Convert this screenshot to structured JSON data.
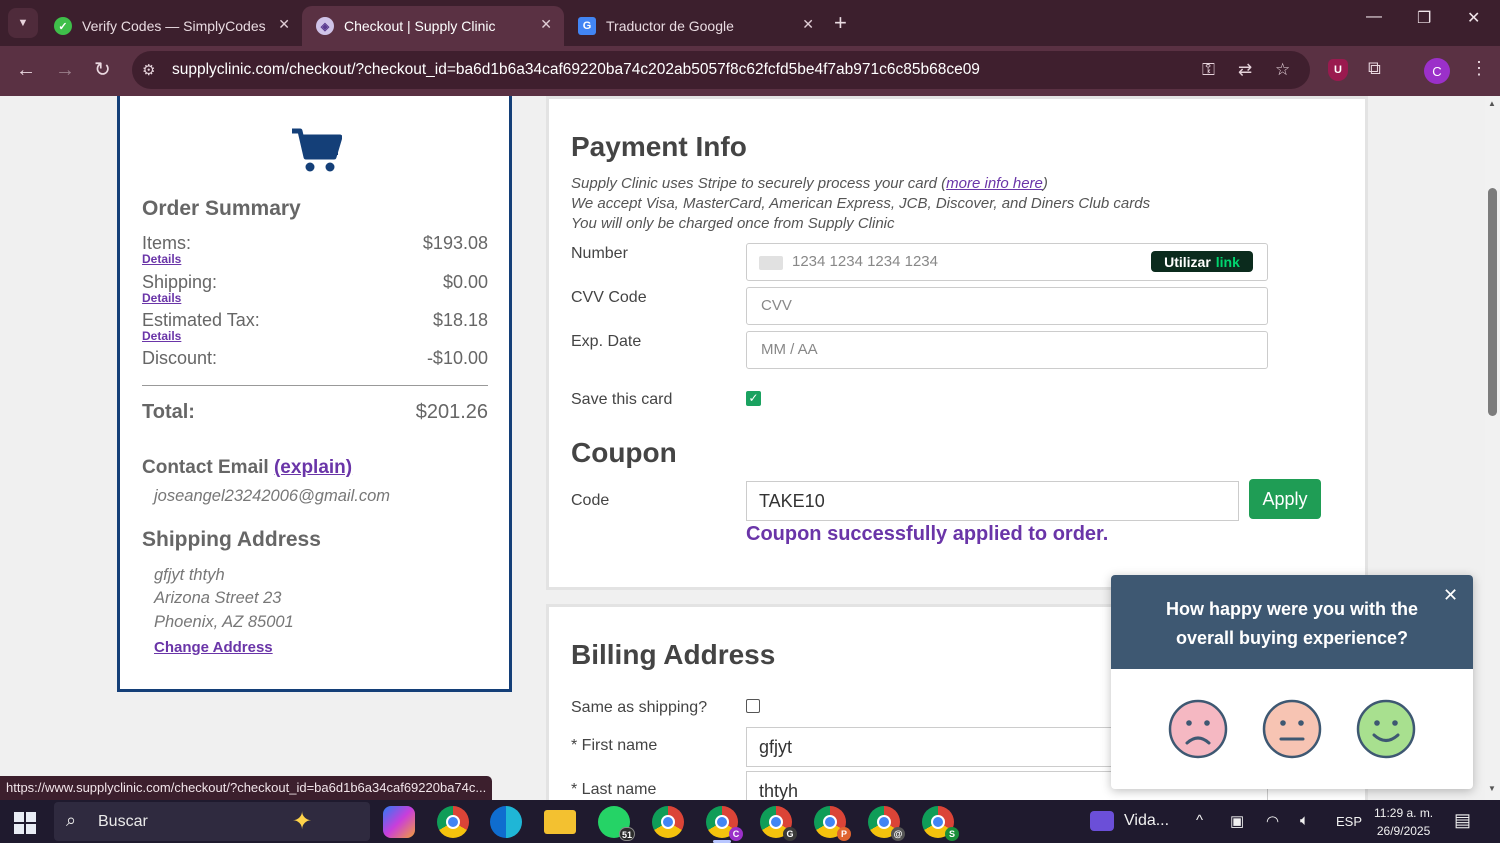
{
  "browser": {
    "tabs": [
      {
        "title": "Verify Codes — SimplyCodes",
        "active": false
      },
      {
        "title": "Checkout | Supply Clinic",
        "active": true
      },
      {
        "title": "Traductor de Google",
        "active": false
      }
    ],
    "url": "supplyclinic.com/checkout/?checkout_id=ba6d1b6a34caf69220ba74c202ab5057f8c62fcfd5be4f7ab971c6c85b68ce09",
    "profile_initial": "C",
    "ublock_letter": "U"
  },
  "order_summary": {
    "title": "Order Summary",
    "rows": [
      {
        "label": "Items:",
        "value": "$193.08",
        "details": "Details"
      },
      {
        "label": "Shipping:",
        "value": "$0.00",
        "details": "Details"
      },
      {
        "label": "Estimated Tax:",
        "value": "$18.18",
        "details": "Details"
      },
      {
        "label": "Discount:",
        "value": "-$10.00"
      }
    ],
    "total_label": "Total:",
    "total_value": "$201.26",
    "contact_title": "Contact Email",
    "explain_link": "(explain)",
    "email": "joseangel23242006@gmail.com",
    "shipping_title": "Shipping Address",
    "address_lines": [
      "gfjyt thtyh",
      "Arizona Street 23",
      "Phoenix, AZ 85001"
    ],
    "change_link": "Change Address"
  },
  "payment": {
    "title": "Payment Info",
    "info_prefix": "Supply Clinic uses Stripe to securely process your card (",
    "info_link": "more info here",
    "info_suffix": ")",
    "info_line2": "We accept Visa, MasterCard, American Express, JCB, Discover, and Diners Club cards",
    "info_line3": "You will only be charged once from Supply Clinic",
    "number_label": "Number",
    "number_placeholder": "1234 1234 1234 1234",
    "link_button": "Utilizar",
    "link_button_brand": "link",
    "cvv_label": "CVV Code",
    "cvv_placeholder": "CVV",
    "exp_label": "Exp. Date",
    "exp_placeholder": "MM / AA",
    "save_label": "Save this card",
    "save_checked": true
  },
  "coupon": {
    "title": "Coupon",
    "code_label": "Code",
    "code_value": "TAKE10",
    "apply_label": "Apply",
    "success_message": "Coupon successfully applied to order."
  },
  "billing": {
    "title": "Billing Address",
    "same_label": "Same as shipping?",
    "same_checked": false,
    "first_name_label": "* First name",
    "first_name_value": "gfjyt",
    "last_name_label": "* Last name",
    "last_name_value": "thtyh"
  },
  "survey": {
    "question": "How happy were you with the overall buying experience?",
    "faces": [
      "sad",
      "neutral",
      "happy"
    ],
    "colors": {
      "sad": "#f5b8c2",
      "neutral": "#f7c4b3",
      "happy": "#a8e08f"
    }
  },
  "status_bar_url": "https://www.supplyclinic.com/checkout/?checkout_id=ba6d1b6a34caf69220ba74c...",
  "taskbar": {
    "search_placeholder": "Buscar",
    "whatsapp_badge": "51",
    "media_label": "Vida...",
    "language": "ESP",
    "time": "11:29 a. m.",
    "date": "26/9/2025"
  },
  "colors": {
    "brand_navy": "#143f78",
    "accent_purple": "#6a35a8",
    "apply_green": "#1f9d55",
    "survey_header": "#3e5872",
    "chrome_frame": "#3c1f2d"
  }
}
